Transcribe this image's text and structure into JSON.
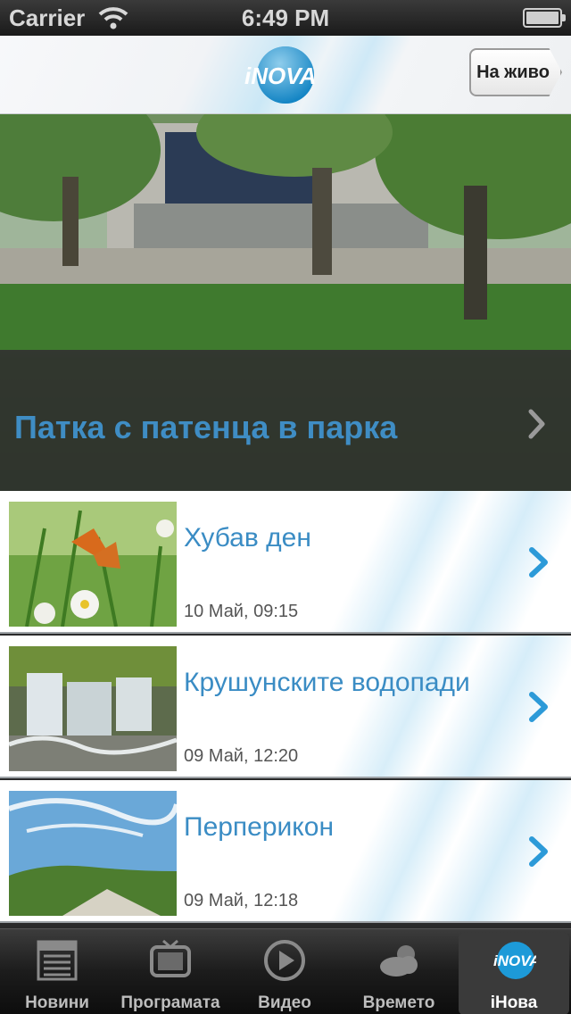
{
  "status_bar": {
    "carrier": "Carrier",
    "time": "6:49 PM"
  },
  "nav": {
    "logo_text": "iNOVA",
    "live_button_label": "На живо"
  },
  "hero": {
    "title": "Патка с патенца в парка"
  },
  "list": {
    "items": [
      {
        "title": "Хубав ден",
        "date": "10 Май, 09:15"
      },
      {
        "title": "Крушунските водопади",
        "date": "09 Май, 12:20"
      },
      {
        "title": "Перперикон",
        "date": "09 Май, 12:18"
      }
    ]
  },
  "tabs": [
    {
      "label": "Новини",
      "icon": "news-icon"
    },
    {
      "label": "Програмата",
      "icon": "tv-icon"
    },
    {
      "label": "Видео",
      "icon": "play-icon"
    },
    {
      "label": "Времето",
      "icon": "cloud-icon"
    },
    {
      "label": "iНова",
      "icon": "inova-logo-icon"
    }
  ],
  "colors": {
    "accent": "#3f8dc4",
    "tab_bar": "#1c1c1c"
  }
}
